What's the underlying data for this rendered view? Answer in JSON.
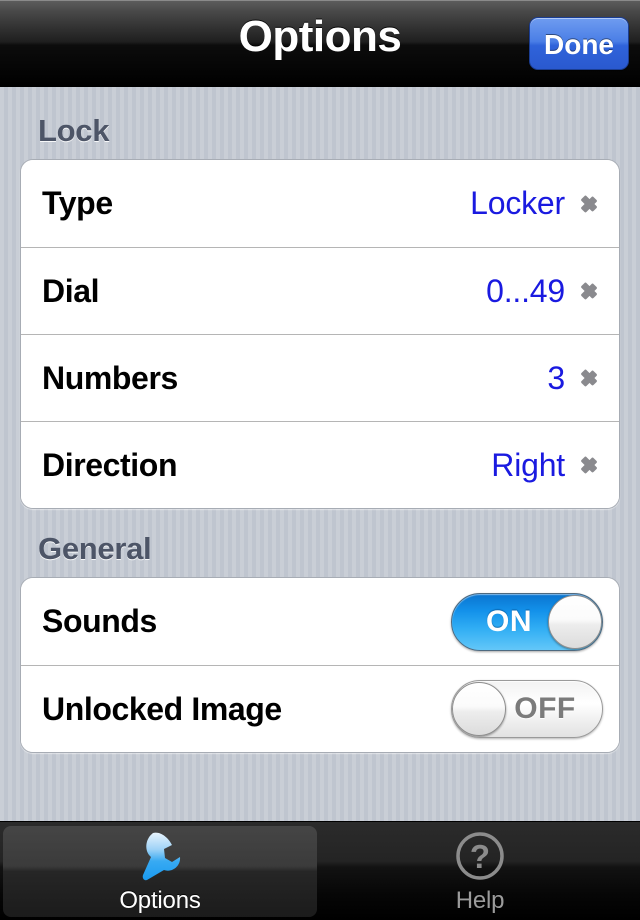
{
  "navbar": {
    "title": "Options",
    "done_label": "Done",
    "done_color": "#3f74e2"
  },
  "sections": [
    {
      "header": "Lock",
      "rows": [
        {
          "label": "Type",
          "value": "Locker",
          "accessory": "chevron-icon"
        },
        {
          "label": "Dial",
          "value": "0...49",
          "accessory": "chevron-icon"
        },
        {
          "label": "Numbers",
          "value": "3",
          "accessory": "chevron-icon"
        },
        {
          "label": "Direction",
          "value": "Right",
          "accessory": "chevron-icon"
        }
      ]
    },
    {
      "header": "General",
      "rows": [
        {
          "label": "Sounds",
          "switch_state": "ON",
          "switch_on": true
        },
        {
          "label": "Unlocked Image",
          "switch_state": "OFF",
          "switch_on": false
        }
      ]
    }
  ],
  "tabbar": {
    "tabs": [
      {
        "label": "Options",
        "icon": "wrench-icon",
        "selected": true
      },
      {
        "label": "Help",
        "icon": "question-mark-icon",
        "selected": false
      }
    ]
  },
  "colors": {
    "value_blue": "#1a1ae0",
    "header_gray": "#4d5567",
    "switch_on_blue": "#1391ea",
    "background": "#c8cdd5"
  }
}
